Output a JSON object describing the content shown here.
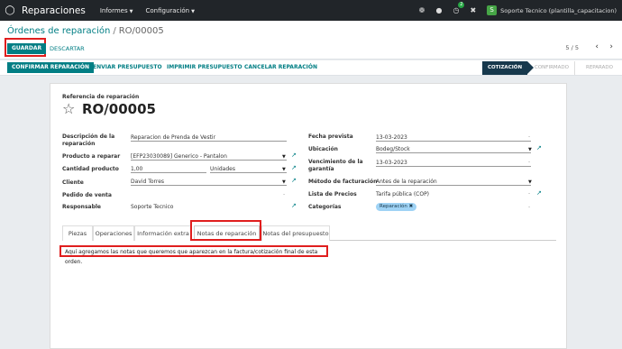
{
  "navbar": {
    "app_title": "Reparaciones",
    "menus": [
      "Informes",
      "Configuración"
    ],
    "chat_badge": "2",
    "avatar_letter": "S",
    "user_name": "Soporte Tecnico (plantilla_capacitacion)"
  },
  "breadcrumb": {
    "parent": "Órdenes de reparación",
    "separator": "/",
    "current": "RO/00005"
  },
  "buttons": {
    "save": "GUARDAR",
    "discard": "DESCARTAR"
  },
  "pager": {
    "value": "5 / 5"
  },
  "actions": {
    "confirm": "CONFIRMAR REPARACIÓN",
    "send_quote": "ENVIAR PRESUPUESTO",
    "print_quote": "IMPRIMIR PRESUPUESTO",
    "cancel": "CANCELAR REPARACIÓN"
  },
  "stages": {
    "active": "COTIZACIÓN",
    "second": "CONFIRMADO",
    "third": "REPARADO"
  },
  "form": {
    "ref_label": "Referencia de reparación",
    "ref_name": "RO/00005",
    "left": {
      "descripcion_label": "Descripción de la reparación",
      "descripcion_value": "Reparacion de Prenda de Vestir",
      "producto_label": "Producto a reparar",
      "producto_value": "[EFP23030089] Generico - Pantalon",
      "cantidad_label": "Cantidad producto",
      "cantidad_value": "1,00",
      "unidad_value": "Unidades",
      "cliente_label": "Cliente",
      "cliente_value": "David Torres",
      "pedido_label": "Pedido de venta",
      "responsable_label": "Responsable",
      "responsable_value": "Soporte Tecnico"
    },
    "right": {
      "fecha_label": "Fecha prevista",
      "fecha_value": "13-03-2023",
      "ubicacion_label": "Ubicación",
      "ubicacion_value": "Bodeg/Stock",
      "vencimiento_label": "Vencimiento de la garantía",
      "vencimiento_value": "13-03-2023",
      "metodo_label": "Método de facturación",
      "metodo_value": "Antes de la reparación",
      "lista_label": "Lista de Precios",
      "lista_value": "Tarifa pública (COP)",
      "categorias_label": "Categorías",
      "categoria_tag": "Reparación"
    }
  },
  "tabs": [
    "Piezas",
    "Operaciones",
    "Información extra",
    "Notas de reparación",
    "Notas del presupuesto"
  ],
  "notes_text": "Aquí agregamos las notas que queremos que aparezcan en la factura/cotización final de esta orden."
}
